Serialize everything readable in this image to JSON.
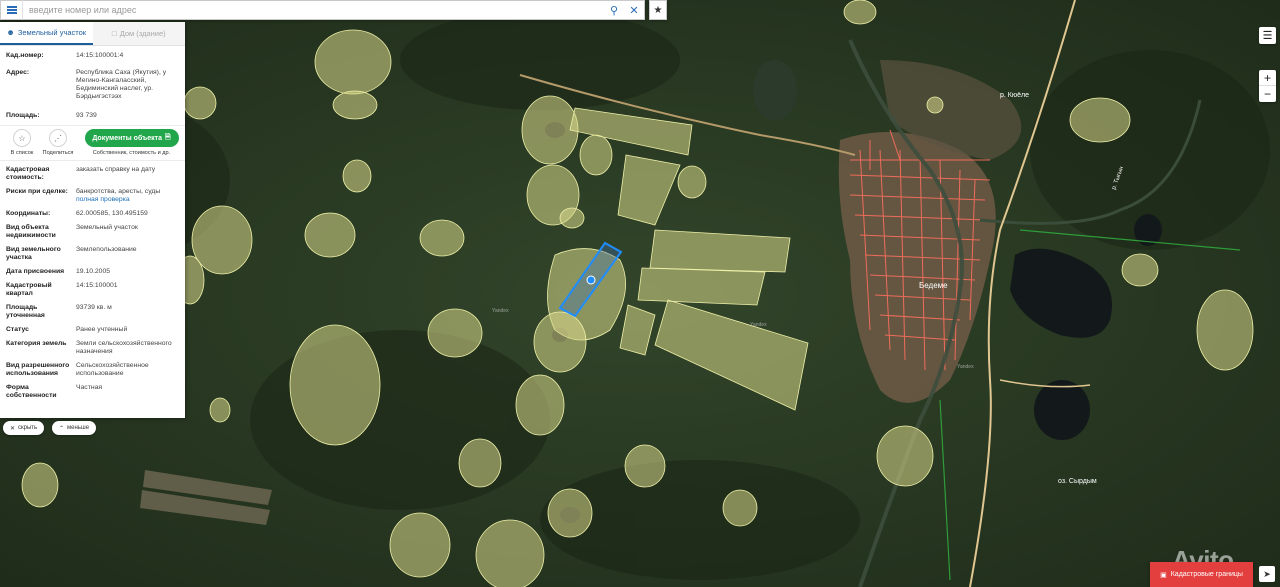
{
  "search": {
    "placeholder": "введите номер или адрес"
  },
  "tabs": [
    {
      "label": "Земельный участок",
      "active": true
    },
    {
      "label": "Дом (здание)",
      "active": false
    }
  ],
  "parcel": {
    "kad_label": "Кад.номер:",
    "kad_value": "14:15:100001:4",
    "address_label": "Адрес:",
    "address_value": "Республика Саха (Якутия), у Мегино-Кангаласский, Бедиминский наслег, ур. Бэрдьигэстээх",
    "area_label": "Площадь:",
    "area_value": "93 739"
  },
  "actions": {
    "to_list": "В список",
    "share": "Поделиться",
    "doc_button": "Документы объекта",
    "doc_sub": "Собственник, стоимость и др."
  },
  "details": [
    {
      "label": "Кадастровая стоимость:",
      "value": "заказать справку на дату",
      "link": true
    },
    {
      "label": "Риски при сделке:",
      "value": "банкротства, аресты, суды",
      "value2": "полная проверка"
    },
    {
      "label": "Координаты:",
      "value": "62.000585, 130.495159"
    },
    {
      "label": "Вид объекта недвижимости",
      "value": "Земельный участок"
    },
    {
      "label": "Вид земельного участка",
      "value": "Землепользование"
    },
    {
      "label": "Дата присвоения",
      "value": "19.10.2005"
    },
    {
      "label": "Кадастровый квартал",
      "value": "14:15:100001"
    },
    {
      "label": "Площадь уточненная",
      "value": "93739 кв. м"
    },
    {
      "label": "Статус",
      "value": "Ранее учтенный"
    },
    {
      "label": "Категория земель",
      "value": "Земли сельскохозяйственного назначения"
    },
    {
      "label": "Вид разрешенного использования",
      "value": "Сельскохозяйственное использование"
    },
    {
      "label": "Форма собственности",
      "value": "Частная"
    }
  ],
  "pills": {
    "hide": "скрыть",
    "less": "меньше"
  },
  "map": {
    "town": "Бедеме",
    "lake": "оз. Сырдым",
    "river1": "р. Кюёле",
    "river2": "р. Тыгын",
    "watermark": "Yandex"
  },
  "controls": {
    "zoom_in": "+",
    "zoom_out": "−"
  },
  "boundaries": "Кадастровые границы",
  "avito": "Avito"
}
